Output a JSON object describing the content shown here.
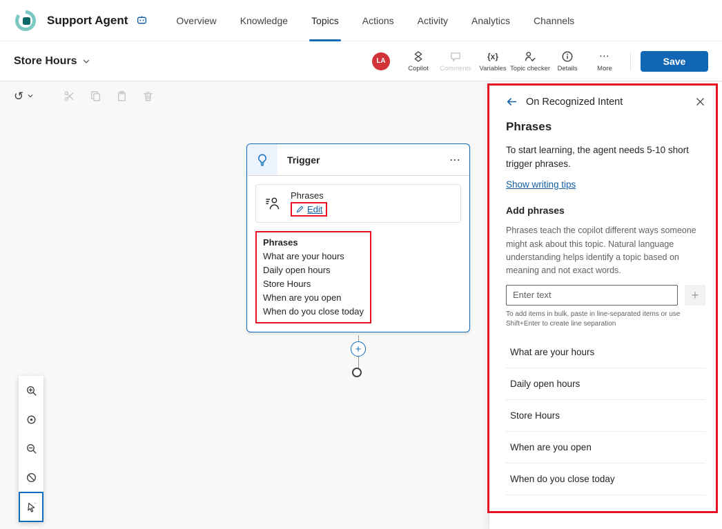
{
  "icons": {
    "undo": "↺",
    "more_horizontal": "⋯",
    "plus": "+",
    "variables": "{x}"
  },
  "topnav": {
    "app_title": "Support Agent",
    "active_tab": "Topics",
    "tabs": [
      {
        "label": "Overview"
      },
      {
        "label": "Knowledge"
      },
      {
        "label": "Topics"
      },
      {
        "label": "Actions"
      },
      {
        "label": "Activity"
      },
      {
        "label": "Analytics"
      },
      {
        "label": "Channels"
      }
    ]
  },
  "topic_bar": {
    "topic_name": "Store Hours",
    "avatar_initials": "LA",
    "actions": [
      {
        "label": "Copilot"
      },
      {
        "label": "Comments"
      },
      {
        "label": "Variables"
      },
      {
        "label": "Topic checker"
      },
      {
        "label": "Details"
      },
      {
        "label": "More"
      }
    ],
    "save_label": "Save"
  },
  "canvas": {
    "trigger_node": {
      "title": "Trigger",
      "phrases_card_label": "Phrases",
      "edit_label": "Edit",
      "summary_heading": "Phrases",
      "phrases": [
        "What are your hours",
        "Daily open hours",
        "Store Hours",
        "When are you open",
        "When do you close today"
      ]
    }
  },
  "panel": {
    "header_title": "On Recognized Intent",
    "section_title": "Phrases",
    "intro": "To start learning, the agent needs 5-10 short trigger phrases.",
    "tips_link": "Show writing tips",
    "add_heading": "Add phrases",
    "description": "Phrases teach the copilot different ways someone might ask about this topic. Natural language understanding helps identify a topic based on meaning and not exact words.",
    "input_placeholder": "Enter text",
    "bulk_hint": "To add items in bulk, paste in line-separated items or use Shift+Enter to create line separation",
    "phrases": [
      "What are your hours",
      "Daily open hours",
      "Store Hours",
      "When are you open",
      "When do you close today"
    ]
  },
  "colors": {
    "accent": "#0f6cbd",
    "link": "#115ea3",
    "annotation_red": "#e81123",
    "avatar_bg": "#d13438",
    "save_button": "#1267b4"
  }
}
